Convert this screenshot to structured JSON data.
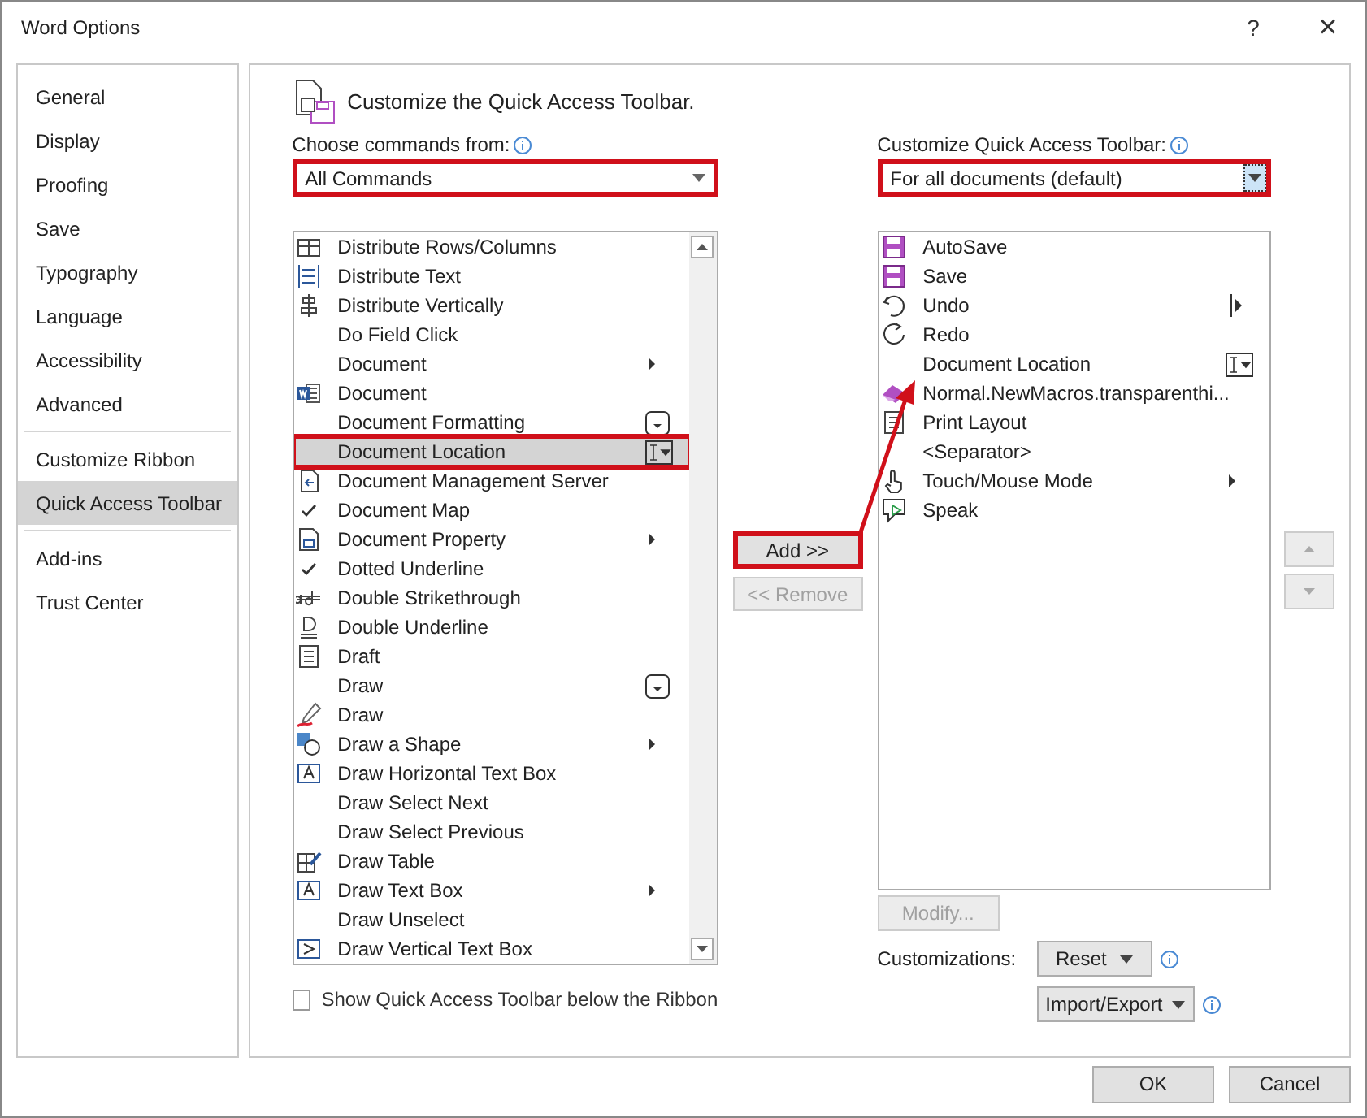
{
  "window": {
    "title": "Word Options",
    "help": "?",
    "close": "×"
  },
  "sidebar": {
    "groups": [
      [
        {
          "label": "General",
          "selected": false
        },
        {
          "label": "Display",
          "selected": false
        },
        {
          "label": "Proofing",
          "selected": false
        },
        {
          "label": "Save",
          "selected": false
        },
        {
          "label": "Typography",
          "selected": false
        },
        {
          "label": "Language",
          "selected": false
        },
        {
          "label": "Accessibility",
          "selected": false
        },
        {
          "label": "Advanced",
          "selected": false
        }
      ],
      [
        {
          "label": "Customize Ribbon",
          "selected": false
        },
        {
          "label": "Quick Access Toolbar",
          "selected": true
        }
      ],
      [
        {
          "label": "Add-ins",
          "selected": false
        },
        {
          "label": "Trust Center",
          "selected": false
        }
      ]
    ]
  },
  "heading": "Customize the Quick Access Toolbar.",
  "commands_from": {
    "label": "Choose commands from:",
    "value": "All Commands",
    "highlighted": true
  },
  "commands": [
    {
      "label": "Distribute Rows/Columns",
      "selected": false
    },
    {
      "label": "Distribute Text",
      "selected": false
    },
    {
      "label": "Distribute Vertically",
      "selected": false
    },
    {
      "label": "Do Field Click",
      "selected": false
    },
    {
      "label": "Document",
      "selected": false
    },
    {
      "label": "Document",
      "selected": false
    },
    {
      "label": "Document Formatting",
      "selected": false
    },
    {
      "label": "Document Location",
      "selected": true
    },
    {
      "label": "Document Management Server",
      "selected": false
    },
    {
      "label": "Document Map",
      "selected": false
    },
    {
      "label": "Document Property",
      "selected": false
    },
    {
      "label": "Dotted Underline",
      "selected": false
    },
    {
      "label": "Double Strikethrough",
      "selected": false
    },
    {
      "label": "Double Underline",
      "selected": false
    },
    {
      "label": "Draft",
      "selected": false
    },
    {
      "label": "Draw",
      "selected": false
    },
    {
      "label": "Draw",
      "selected": false
    },
    {
      "label": "Draw a Shape",
      "selected": false
    },
    {
      "label": "Draw Horizontal Text Box",
      "selected": false
    },
    {
      "label": "Draw Select Next",
      "selected": false
    },
    {
      "label": "Draw Select Previous",
      "selected": false
    },
    {
      "label": "Draw Table",
      "selected": false
    },
    {
      "label": "Draw Text Box",
      "selected": false
    },
    {
      "label": "Draw Unselect",
      "selected": false
    },
    {
      "label": "Draw Vertical Text Box",
      "selected": false
    }
  ],
  "show_below": {
    "label": "Show Quick Access Toolbar below the Ribbon",
    "checked": false
  },
  "add_button": {
    "label": "Add >>",
    "highlighted": true
  },
  "remove_button": {
    "label": "<< Remove",
    "disabled": true
  },
  "toolbar_for": {
    "label": "Customize Quick Access Toolbar:",
    "value": "For all documents (default)",
    "highlighted": true
  },
  "toolbar_items": [
    "AutoSave",
    "Save",
    "Undo",
    "Redo",
    "Document Location",
    "Normal.NewMacros.transparenthi...",
    "Print Layout",
    "<Separator>",
    "Touch/Mouse Mode",
    "Speak"
  ],
  "modify_button": {
    "label": "Modify...",
    "disabled": true
  },
  "customizations": {
    "label": "Customizations:",
    "reset": "Reset",
    "import_export": "Import/Export"
  },
  "footer": {
    "ok": "OK",
    "cancel": "Cancel"
  }
}
